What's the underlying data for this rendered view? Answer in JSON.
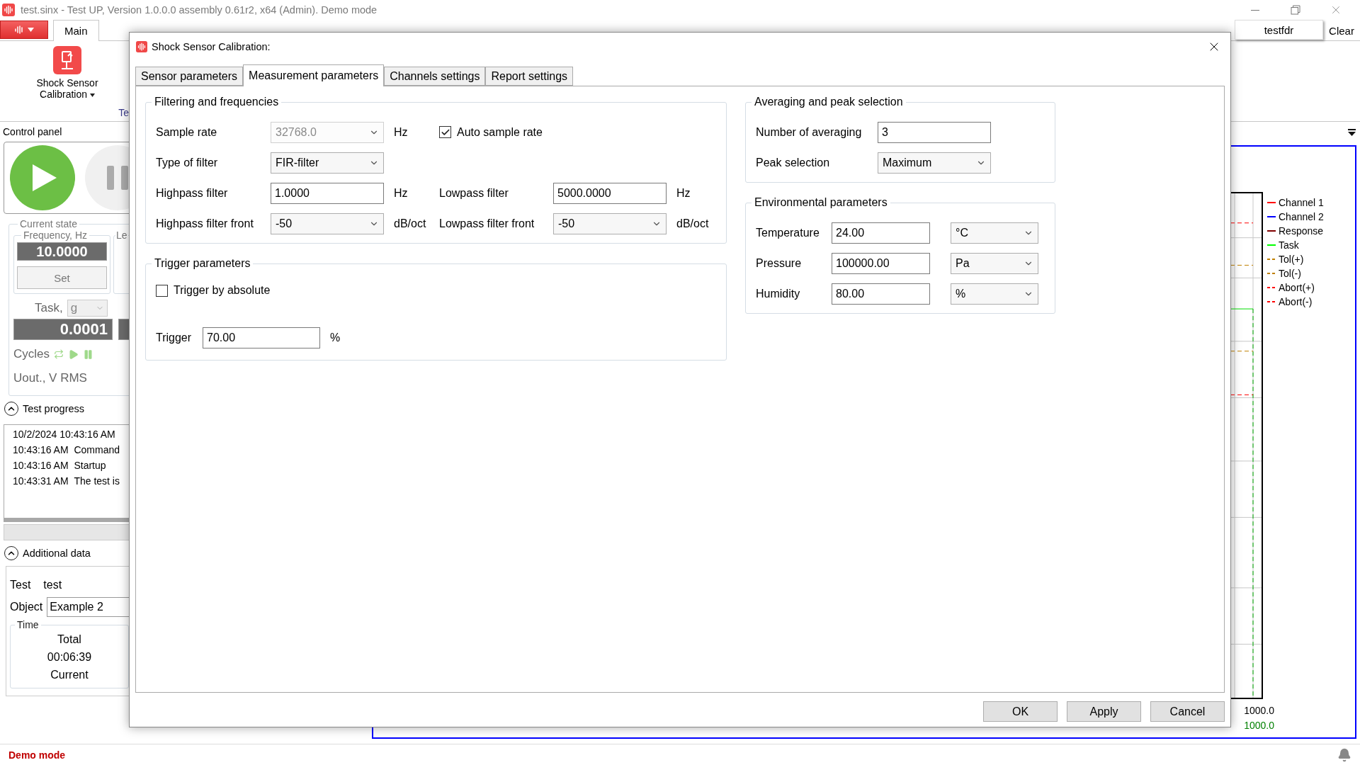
{
  "window": {
    "title": "test.sinx - Test UP, Version 1.0.0.0 assembly 0.61r2,  x64  (Admin). Demo mode"
  },
  "ribbon": {
    "tabs": [
      {
        "label": "Main",
        "selected": true
      }
    ],
    "command": {
      "label": "Shock Sensor Calibration"
    },
    "group_label": "Te",
    "doc_tabs": [
      {
        "label": "testfdr"
      }
    ],
    "clear_button": "Clear"
  },
  "control_panel": {
    "title": "Control panel",
    "current_state": {
      "title": "Current state",
      "frequency": {
        "title": "Frequency, Hz",
        "value": "10.0000",
        "button": "Set"
      },
      "level_title": "Le",
      "task": {
        "label": "Task,",
        "unit": "g",
        "value": "0.0001"
      },
      "cycles": "Cycles",
      "uout": "Uout., V RMS"
    },
    "test_progress": {
      "title": "Test progress",
      "expanded": true,
      "log": [
        {
          "time": "10/2/2024 10:43:16 AM"
        },
        {
          "time": "10:43:16 AM",
          "text": "Command"
        },
        {
          "time": "10:43:16 AM",
          "text": "Startup"
        },
        {
          "time": "10:43:31 AM",
          "text": "The test is"
        }
      ]
    },
    "additional_data": {
      "title": "Additional data",
      "expanded": true,
      "test_label": "Test",
      "test_value": "test",
      "object_label": "Object",
      "object_value": "Example 2",
      "time": {
        "title": "Time",
        "total_label": "Total",
        "total": "00:06:39",
        "current_label": "Current"
      }
    }
  },
  "chart": {
    "legend": [
      {
        "label": "Channel 1",
        "color": "#ff0000",
        "kind": "solid"
      },
      {
        "label": "Channel 2",
        "color": "#0000ff",
        "kind": "solid"
      },
      {
        "label": "Response",
        "color": "#800000",
        "kind": "solid"
      },
      {
        "label": "Task",
        "color": "#00ff00",
        "kind": "solid"
      },
      {
        "label": "Tol(+)",
        "color": "#c08000",
        "kind": "dashed"
      },
      {
        "label": "Tol(-)",
        "color": "#c08000",
        "kind": "dashed"
      },
      {
        "label": "Abort(+)",
        "color": "#ff0000",
        "kind": "dashed"
      },
      {
        "label": "Abort(-)",
        "color": "#ff0000",
        "kind": "dashed"
      }
    ],
    "axis_labels": [
      {
        "text": "1000.0",
        "color": "#000000"
      },
      {
        "text": "1000.0",
        "color": "#008000"
      }
    ]
  },
  "status_bar": {
    "text": "Demo mode"
  },
  "dialog": {
    "title": "Shock Sensor Calibration:",
    "tabs": [
      {
        "label": "Sensor parameters",
        "selected": false
      },
      {
        "label": "Measurement parameters",
        "selected": true
      },
      {
        "label": "Channels settings",
        "selected": false
      },
      {
        "label": "Report settings",
        "selected": false
      }
    ],
    "filtering": {
      "title": "Filtering and frequencies",
      "sample_rate": {
        "label": "Sample rate",
        "value": "32768.0",
        "disabled": true,
        "unit": "Hz"
      },
      "auto_sample_rate": {
        "label": "Auto sample rate",
        "checked": true
      },
      "filter_type": {
        "label": "Type of filter",
        "value": "FIR-filter"
      },
      "highpass": {
        "label": "Highpass filter",
        "value": "1.0000",
        "unit": "Hz"
      },
      "lowpass": {
        "label": "Lowpass filter",
        "value": "5000.0000",
        "unit": "Hz"
      },
      "highpass_front": {
        "label": "Highpass filter front",
        "value": "-50",
        "unit": "dB/oct"
      },
      "lowpass_front": {
        "label": "Lowpass filter front",
        "value": "-50",
        "unit": "dB/oct"
      }
    },
    "trigger": {
      "title": "Trigger parameters",
      "by_absolute": {
        "label": "Trigger by absolute",
        "checked": false
      },
      "trigger": {
        "label": "Trigger",
        "value": "70.00",
        "unit": "%"
      }
    },
    "averaging": {
      "title": "Averaging and peak selection",
      "count": {
        "label": "Number of averaging",
        "value": "3"
      },
      "peak": {
        "label": "Peak selection",
        "value": "Maximum"
      }
    },
    "environment": {
      "title": "Environmental parameters",
      "rows": [
        {
          "label": "Temperature",
          "value": "24.00",
          "unit": "°C"
        },
        {
          "label": "Pressure",
          "value": "100000.00",
          "unit": "Pa"
        },
        {
          "label": "Humidity",
          "value": "80.00",
          "unit": "%"
        }
      ]
    },
    "buttons": [
      "OK",
      "Apply",
      "Cancel"
    ]
  }
}
